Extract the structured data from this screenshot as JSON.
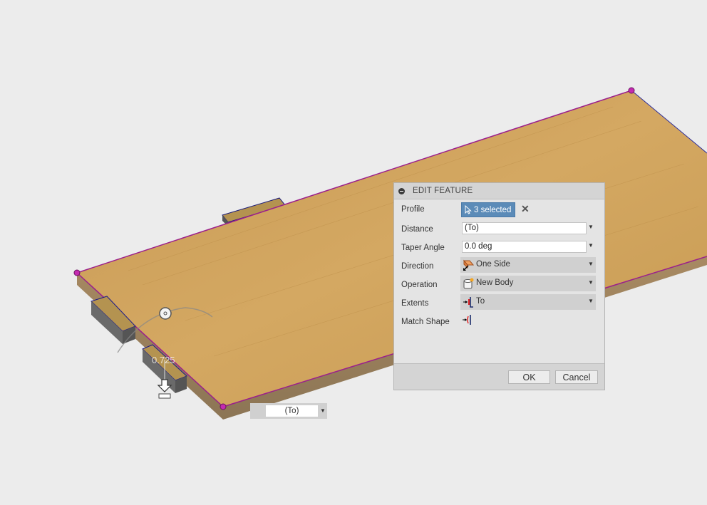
{
  "viewport": {
    "background": "#ececec",
    "dimension_value": "0.725",
    "floating_extent_value": "(To)",
    "board_color": "#c9a05a",
    "edge_highlight": "#9b1f8c"
  },
  "dialog": {
    "title": "EDIT FEATURE",
    "rows": {
      "profile": {
        "label": "Profile",
        "value": "3 selected",
        "icon": "cursor-arrow-icon"
      },
      "distance": {
        "label": "Distance",
        "value": "(To)"
      },
      "taper": {
        "label": "Taper Angle",
        "value": "0.0 deg"
      },
      "direction": {
        "label": "Direction",
        "value": "One Side",
        "icon": "one-side-direction-icon"
      },
      "operation": {
        "label": "Operation",
        "value": "New Body",
        "icon": "new-body-icon"
      },
      "extents": {
        "label": "Extents",
        "value": "To",
        "icon": "extent-to-icon"
      },
      "match_shape": {
        "label": "Match Shape",
        "icon": "match-shape-icon"
      }
    },
    "ok_label": "OK",
    "cancel_label": "Cancel",
    "accent": "#5b8bb8"
  }
}
